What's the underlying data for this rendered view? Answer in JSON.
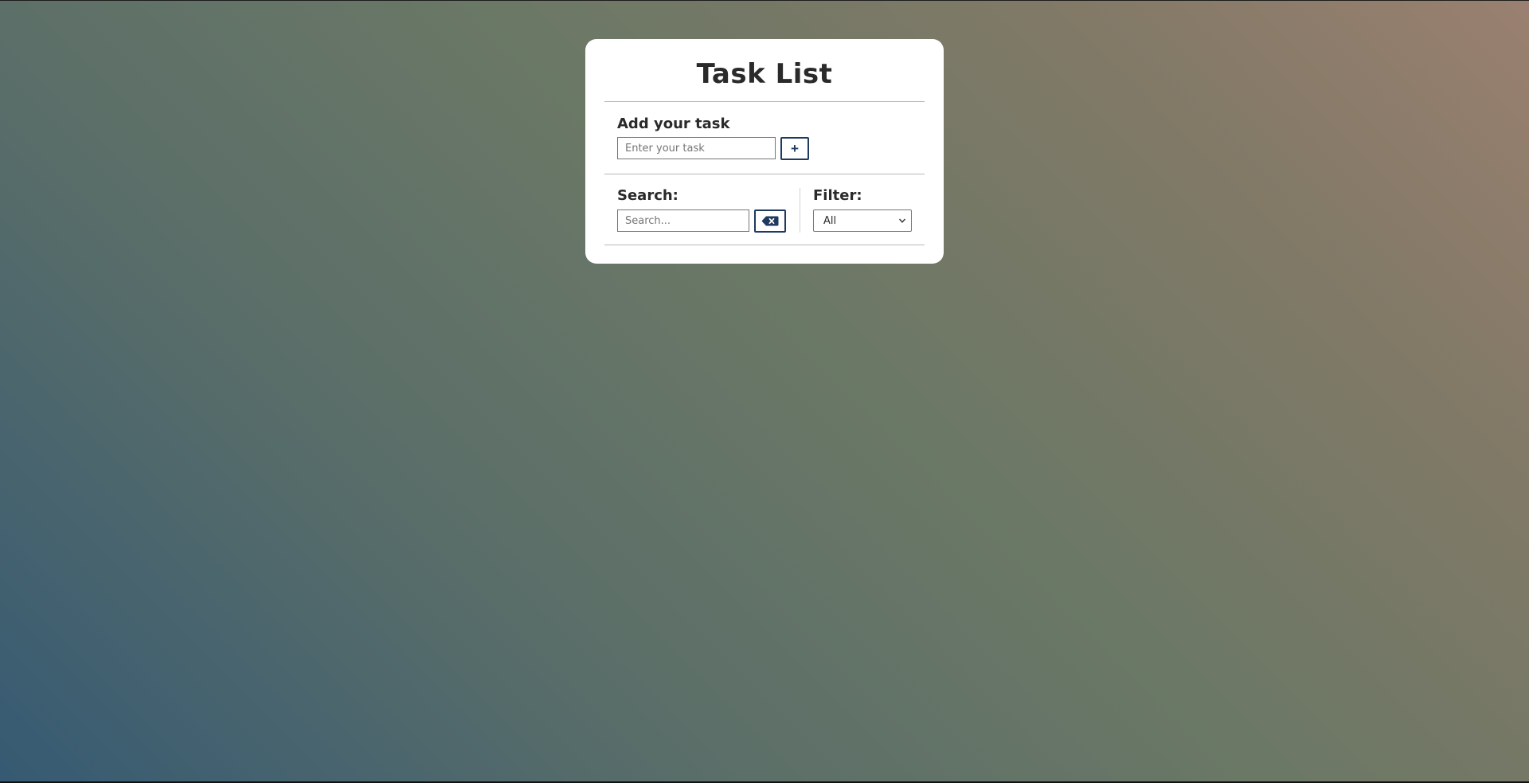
{
  "app": {
    "title": "Task List"
  },
  "add_task": {
    "label": "Add your task",
    "placeholder": "Enter your task",
    "value": "",
    "add_button_label": "+"
  },
  "search": {
    "label": "Search:",
    "placeholder": "Search...",
    "value": "",
    "clear_icon": "backspace-icon"
  },
  "filter": {
    "label": "Filter:",
    "selected": "All"
  },
  "colors": {
    "accent": "#1e3a5f",
    "card_background": "#ffffff",
    "gradient_start": "#365a73",
    "gradient_end": "#9a8070"
  }
}
